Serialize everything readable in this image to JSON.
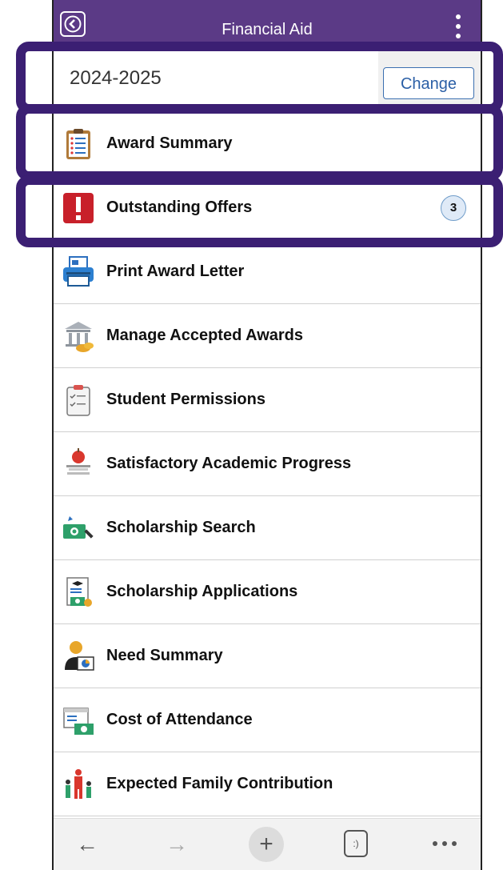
{
  "header": {
    "title": "Financial Aid",
    "back_icon": "back-chevron-icon",
    "menu_icon": "kebab-menu-icon"
  },
  "aid_year": {
    "value": "2024-2025",
    "change_label": "Change"
  },
  "menu_items": [
    {
      "label": "Award Summary",
      "icon": "clipboard-list-icon"
    },
    {
      "label": "Outstanding Offers",
      "icon": "exclamation-icon",
      "badge": "3"
    },
    {
      "label": "Print Award Letter",
      "icon": "printer-icon"
    },
    {
      "label": "Manage Accepted Awards",
      "icon": "bank-coins-icon"
    },
    {
      "label": "Student Permissions",
      "icon": "checklist-clipboard-icon"
    },
    {
      "label": "Satisfactory Academic Progress",
      "icon": "apple-books-icon"
    },
    {
      "label": "Scholarship Search",
      "icon": "money-search-icon"
    },
    {
      "label": "Scholarship Applications",
      "icon": "application-document-icon"
    },
    {
      "label": "Need Summary",
      "icon": "person-chart-icon"
    },
    {
      "label": "Cost of Attendance",
      "icon": "cost-document-icon"
    },
    {
      "label": "Expected Family Contribution",
      "icon": "family-icon"
    }
  ],
  "browser_bar": {
    "back": "←",
    "forward": "→",
    "new_tab": "+",
    "tabs": ":)",
    "more_icon": "more-dots-icon"
  },
  "colors": {
    "header_bg": "#5b3a86",
    "highlight": "#3b1f73",
    "link_blue": "#2b5fa6",
    "alert_red": "#c8202a"
  }
}
